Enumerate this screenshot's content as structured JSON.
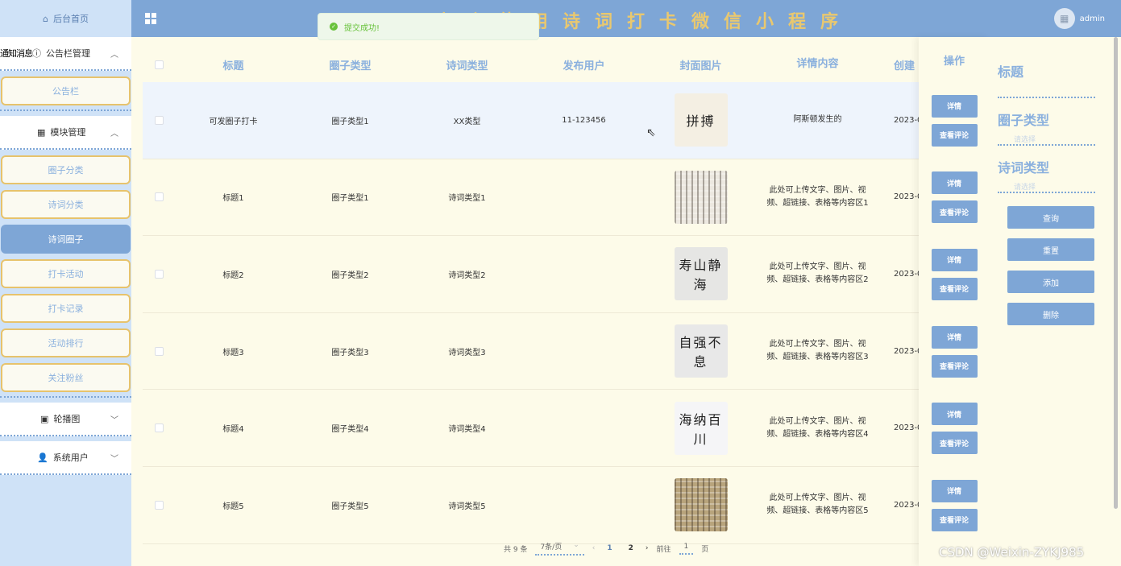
{
  "header": {
    "title": "欢迎使用诗词打卡微信小程序",
    "username": "admin"
  },
  "toast": {
    "message": "提交成功!"
  },
  "sidebar": {
    "home": "后台首页",
    "group1": {
      "label": "公告栏管理",
      "ghost": "通知消息"
    },
    "group1_items": [
      "公告栏"
    ],
    "group2": {
      "label": "模块管理"
    },
    "group2_items": [
      "圈子分类",
      "诗词分类",
      "诗词圈子",
      "打卡活动",
      "打卡记录",
      "活动排行",
      "关注粉丝"
    ],
    "group3": {
      "label": "轮播图"
    },
    "group4": {
      "label": "系统用户"
    }
  },
  "table": {
    "headers": [
      "标题",
      "圈子类型",
      "诗词类型",
      "发布用户",
      "封面图片",
      "详情内容",
      "创建"
    ],
    "ops_header": "操作",
    "rows": [
      {
        "title": "可发圈子打卡",
        "circle": "圈子类型1",
        "poem": "XX类型",
        "user": "11-123456",
        "detail": "阿斯顿发生的",
        "created": "2023-0"
      },
      {
        "title": "标题1",
        "circle": "圈子类型1",
        "poem": "诗词类型1",
        "user": "",
        "detail": "此处可上传文字、图片、视频、超链接、表格等内容区1",
        "created": "2023-0"
      },
      {
        "title": "标题2",
        "circle": "圈子类型2",
        "poem": "诗词类型2",
        "user": "",
        "detail": "此处可上传文字、图片、视频、超链接、表格等内容区2",
        "created": "2023-0"
      },
      {
        "title": "标题3",
        "circle": "圈子类型3",
        "poem": "诗词类型3",
        "user": "",
        "detail": "此处可上传文字、图片、视频、超链接、表格等内容区3",
        "created": "2023-0"
      },
      {
        "title": "标题4",
        "circle": "圈子类型4",
        "poem": "诗词类型4",
        "user": "",
        "detail": "此处可上传文字、图片、视频、超链接、表格等内容区4",
        "created": "2023-0"
      },
      {
        "title": "标题5",
        "circle": "圈子类型5",
        "poem": "诗词类型5",
        "user": "",
        "detail": "此处可上传文字、图片、视频、超链接、表格等内容区5",
        "created": "2023-0"
      }
    ],
    "thumbs": [
      {
        "text": "拼搏",
        "bg": "#f4efe3"
      },
      {
        "text": "",
        "bg": "#ece8e0"
      },
      {
        "text": "寿山静海",
        "bg": "#e6e6e4"
      },
      {
        "text": "自强不息",
        "bg": "#e8e8e8"
      },
      {
        "text": "海纳百川",
        "bg": "#f5f5f7"
      },
      {
        "text": "",
        "bg": "#b8a47c"
      }
    ],
    "btn_detail": "详情",
    "btn_comments": "查看评论"
  },
  "search_panel": {
    "label1": "标题",
    "label2": "圈子类型",
    "placeholder2": "请选择",
    "label3": "诗词类型",
    "placeholder3": "请选择",
    "btn_query": "查询",
    "btn_reset": "重置",
    "btn_add": "添加",
    "btn_delete": "删除"
  },
  "pagination": {
    "total": "共 9 条",
    "page_size": "7条/页",
    "pages": [
      "1",
      "2"
    ],
    "goto_prefix": "前往",
    "goto_value": "1",
    "goto_suffix": "页"
  },
  "watermark": "CSDN @Weixin-ZYKJ985",
  "colors": {
    "accent": "#7ea6d6",
    "title_gold": "#e9c86f",
    "background": "#fdfbe9",
    "success": "#67c23a"
  }
}
